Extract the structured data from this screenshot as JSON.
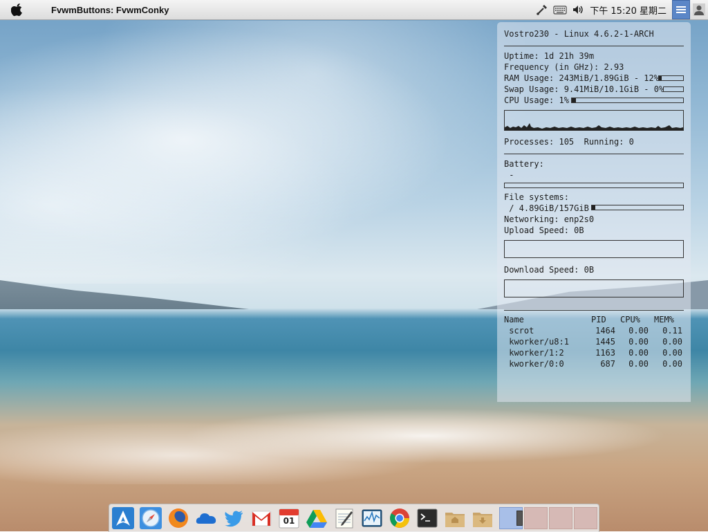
{
  "topbar": {
    "app_title": "FvwmButtons: FvwmConky",
    "clock": "下午 15:20 星期二",
    "icons": [
      "apple-icon",
      "network-icon",
      "keyboard-icon",
      "volume-icon",
      "menu-icon",
      "user-icon"
    ]
  },
  "conky": {
    "host": "Vostro230 - Linux 4.6.2-1-ARCH",
    "uptime": "Uptime: 1d 21h 39m",
    "frequency": "Frequency (in GHz): 2.93",
    "ram": "RAM Usage: 243MiB/1.89GiB - 12%",
    "ram_pct": 12,
    "swap": "Swap Usage: 9.41MiB/10.1GiB - 0%",
    "swap_pct": 0,
    "cpu": "CPU Usage: 1%",
    "cpu_pct": 1,
    "processes": "Processes: 105  Running: 0",
    "battery_label": "Battery:",
    "battery_value": " -",
    "filesystems_label": "File systems:",
    "fs_root": " / 4.89GiB/157GiB",
    "fs_pct": 3,
    "networking": "Networking: enp2s0",
    "upload": "Upload Speed: 0B",
    "download": "Download Speed: 0B",
    "table_headers": [
      "Name",
      "PID",
      "CPU%",
      "MEM%"
    ],
    "top_processes": [
      {
        "name": " scrot",
        "pid": "1464",
        "cpu": "0.00",
        "mem": "0.11"
      },
      {
        "name": " kworker/u8:1",
        "pid": "1445",
        "cpu": "0.00",
        "mem": "0.00"
      },
      {
        "name": " kworker/1:2",
        "pid": "1163",
        "cpu": "0.00",
        "mem": "0.00"
      },
      {
        "name": " kworker/0:0",
        "pid": "687",
        "cpu": "0.00",
        "mem": "0.00"
      }
    ]
  },
  "dock": {
    "items": [
      "arch-linux-icon",
      "safari-icon",
      "firefox-icon",
      "onedrive-icon",
      "twitter-icon",
      "gmail-icon",
      "calendar-icon",
      "google-drive-icon",
      "text-editor-icon",
      "system-monitor-icon",
      "chrome-icon",
      "terminal-icon",
      "home-folder-icon",
      "downloads-folder-icon"
    ],
    "calendar_day": "01",
    "pager_count": 4
  },
  "colors": {
    "accent": "#5b86c7",
    "conky_text": "#1c1c1c",
    "pager_active": "#a8bfe8",
    "pager_inactive": "#d6b9b5"
  }
}
